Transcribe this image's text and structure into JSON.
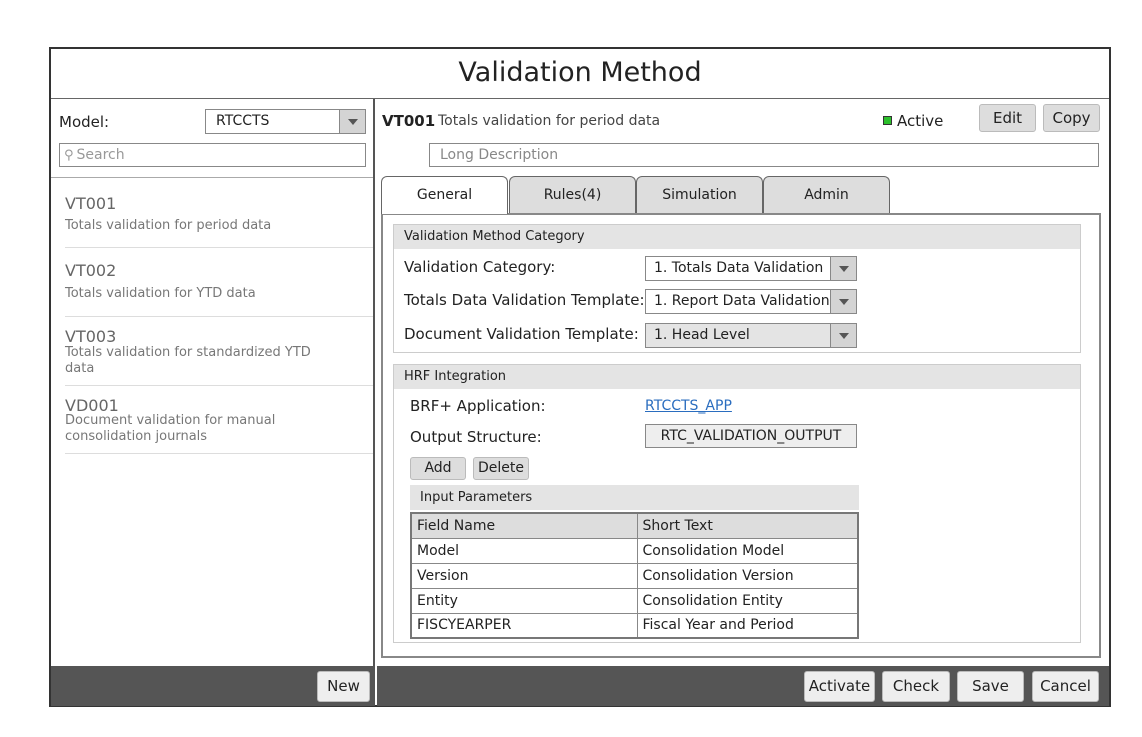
{
  "window": {
    "title": "Validation Method"
  },
  "sidebar": {
    "model_label": "Model:",
    "model_value": "RTCCTS",
    "search_placeholder": "Search",
    "items": [
      {
        "code": "VT001",
        "desc": "Totals validation for period data"
      },
      {
        "code": "VT002",
        "desc": "Totals validation for YTD data"
      },
      {
        "code": "VT003",
        "desc": "Totals validation for standardized YTD data"
      },
      {
        "code": "VD001",
        "desc": "Document validation for manual consolidation journals"
      }
    ],
    "new_label": "New"
  },
  "header": {
    "code": "VT001",
    "desc": "Totals validation for period data",
    "status": "Active",
    "status_color": "#2cc02c",
    "edit_label": "Edit",
    "copy_label": "Copy",
    "long_desc_placeholder": "Long Description"
  },
  "tabs": [
    {
      "label": "General"
    },
    {
      "label": "Rules(4)"
    },
    {
      "label": "Simulation"
    },
    {
      "label": "Admin"
    }
  ],
  "category_section": {
    "title": "Validation Method Category",
    "validation_category_label": "Validation Category:",
    "validation_category_value": "1. Totals Data Validation",
    "totals_template_label": "Totals Data Validation Template:",
    "totals_template_value": "1. Report Data Validation",
    "document_template_label": "Document Validation Template:",
    "document_template_value": "1. Head Level"
  },
  "hrf_section": {
    "title": "HRF Integration",
    "application_label": "BRF+ Application:",
    "application_value": "RTCCTS_APP",
    "output_label": "Output Structure:",
    "output_value": "RTC_VALIDATION_OUTPUT",
    "add_label": "Add",
    "delete_label": "Delete",
    "params_title": "Input Parameters",
    "columns": [
      "Field Name",
      "Short Text"
    ],
    "rows": [
      [
        "Model",
        "Consolidation Model"
      ],
      [
        "Version",
        "Consolidation Version"
      ],
      [
        "Entity",
        "Consolidation Entity"
      ],
      [
        "FISCYEARPER",
        "Fiscal Year and Period"
      ]
    ]
  },
  "footer": {
    "activate_label": "Activate",
    "check_label": "Check",
    "save_label": "Save",
    "cancel_label": "Cancel"
  }
}
